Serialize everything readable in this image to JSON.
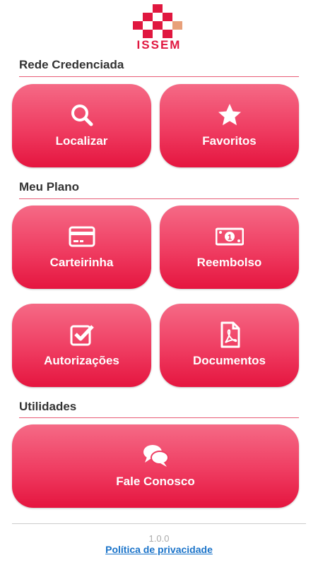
{
  "brand": {
    "name": "ISSEM",
    "color": "#e0173f",
    "accent": "#e8a07a"
  },
  "sections": {
    "rede": {
      "title": "Rede Credenciada"
    },
    "plano": {
      "title": "Meu Plano"
    },
    "utilidades": {
      "title": "Utilidades"
    }
  },
  "tiles": {
    "localizar": {
      "label": "Localizar",
      "icon": "search-icon"
    },
    "favoritos": {
      "label": "Favoritos",
      "icon": "star-icon"
    },
    "carteirinha": {
      "label": "Carteirinha",
      "icon": "card-icon"
    },
    "reembolso": {
      "label": "Reembolso",
      "icon": "money-icon"
    },
    "autorizacoes": {
      "label": "Autorizações",
      "icon": "checkbox-icon"
    },
    "documentos": {
      "label": "Documentos",
      "icon": "pdf-icon"
    },
    "fale": {
      "label": "Fale Conosco",
      "icon": "chat-icon"
    }
  },
  "footer": {
    "version": "1.0.0",
    "privacy_link": "Política de privacidade"
  },
  "colors": {
    "tile_top": "#f56a86",
    "tile_bottom": "#e5153f",
    "link": "#1a73c9",
    "section_line": "#e75c76"
  }
}
